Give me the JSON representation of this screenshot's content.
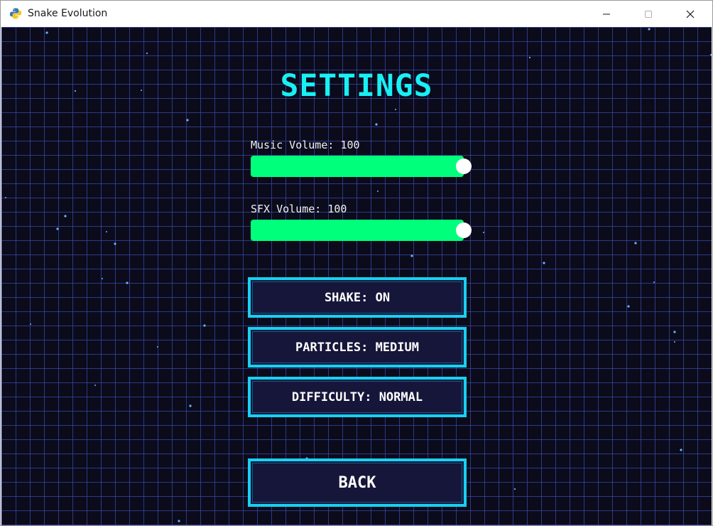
{
  "window": {
    "title": "Snake Evolution",
    "controls": [
      "minimize",
      "maximize",
      "close"
    ]
  },
  "settings": {
    "title": "SETTINGS",
    "music": {
      "label": "Music Volume:",
      "value": "100",
      "level": 1.0
    },
    "sfx": {
      "label": "SFX Volume:",
      "value": "100",
      "level": 1.0
    },
    "buttons": {
      "shake": "SHAKE: ON",
      "particles": "PARTICLES: MEDIUM",
      "difficulty": "DIFFICULTY: NORMAL",
      "back": "BACK"
    }
  },
  "colors": {
    "background": "#0b0b1b",
    "grid": "#3a48aa",
    "title": "#18f0f4",
    "slider_fill": "#00ff7a",
    "button_border": "#18d0f2",
    "button_bg": "#16163a",
    "text": "#ffffff"
  }
}
